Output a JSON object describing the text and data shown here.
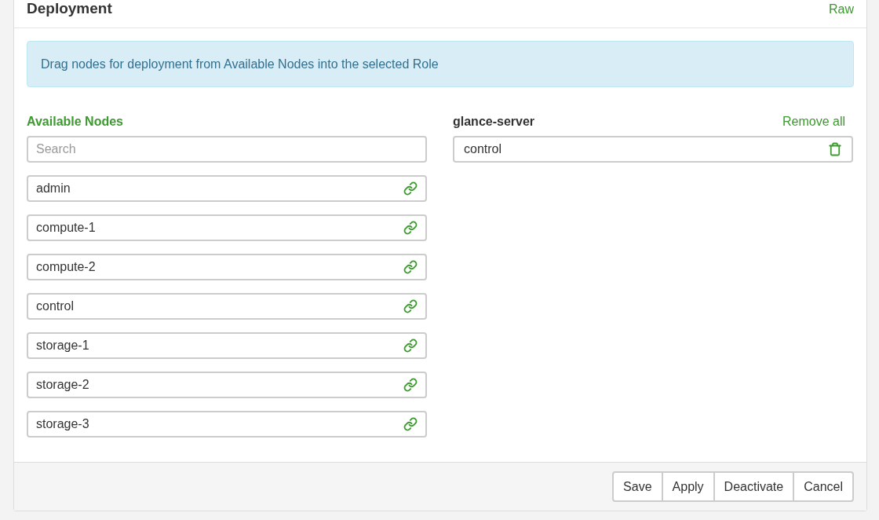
{
  "panel": {
    "title": "Deployment",
    "raw_link": "Raw"
  },
  "alert": "Drag nodes for deployment from Available Nodes into the selected Role",
  "available": {
    "heading": "Available Nodes",
    "search": {
      "placeholder": "Search"
    },
    "nodes": [
      {
        "name": "admin"
      },
      {
        "name": "compute-1"
      },
      {
        "name": "compute-2"
      },
      {
        "name": "control"
      },
      {
        "name": "storage-1"
      },
      {
        "name": "storage-2"
      },
      {
        "name": "storage-3"
      }
    ]
  },
  "role": {
    "name": "glance-server",
    "remove_all": "Remove all",
    "nodes": [
      {
        "name": "control"
      }
    ]
  },
  "buttons": [
    "Save",
    "Apply",
    "Deactivate",
    "Cancel"
  ]
}
